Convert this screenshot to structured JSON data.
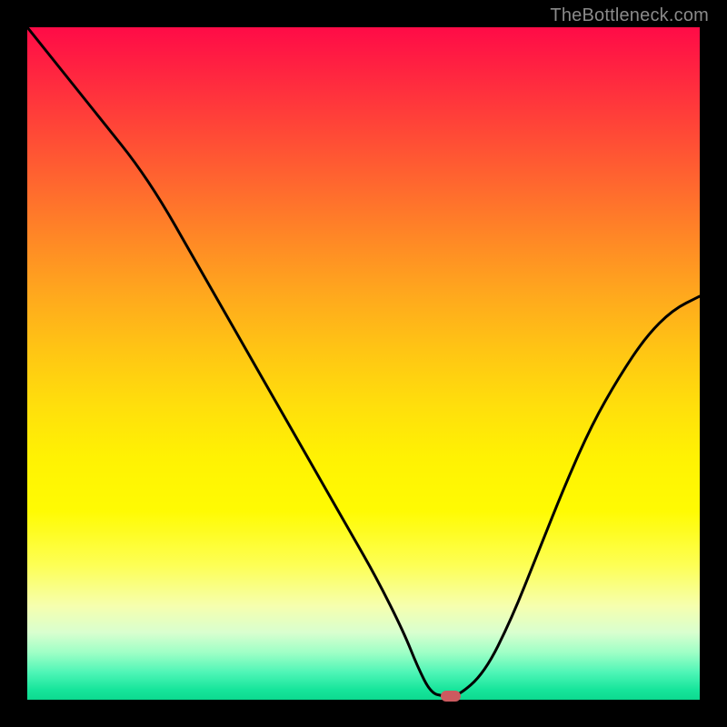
{
  "watermark": "TheBottleneck.com",
  "colors": {
    "frame_bg": "#000000",
    "curve_stroke": "#000000",
    "marker_fill": "#cc5a5f",
    "gradient_top": "#ff0b47",
    "gradient_bottom": "#0dd98f",
    "watermark_text": "#8a8a8a"
  },
  "chart_data": {
    "type": "line",
    "title": "",
    "xlabel": "",
    "ylabel": "",
    "xlim": [
      0,
      100
    ],
    "ylim": [
      0,
      100
    ],
    "grid": false,
    "legend": false,
    "series": [
      {
        "name": "bottleneck-curve",
        "x": [
          0,
          4,
          8,
          12,
          16,
          20,
          24,
          28,
          32,
          36,
          40,
          44,
          48,
          52,
          56,
          58,
          60,
          62,
          64,
          68,
          72,
          76,
          80,
          84,
          88,
          92,
          96,
          100
        ],
        "y": [
          100,
          95,
          90,
          85,
          80,
          74,
          67,
          60,
          53,
          46,
          39,
          32,
          25,
          18,
          10,
          5,
          1,
          0.5,
          0.5,
          4,
          12,
          22,
          32,
          41,
          48,
          54,
          58,
          60
        ]
      }
    ],
    "marker": {
      "x": 63,
      "y": 0.5
    }
  }
}
